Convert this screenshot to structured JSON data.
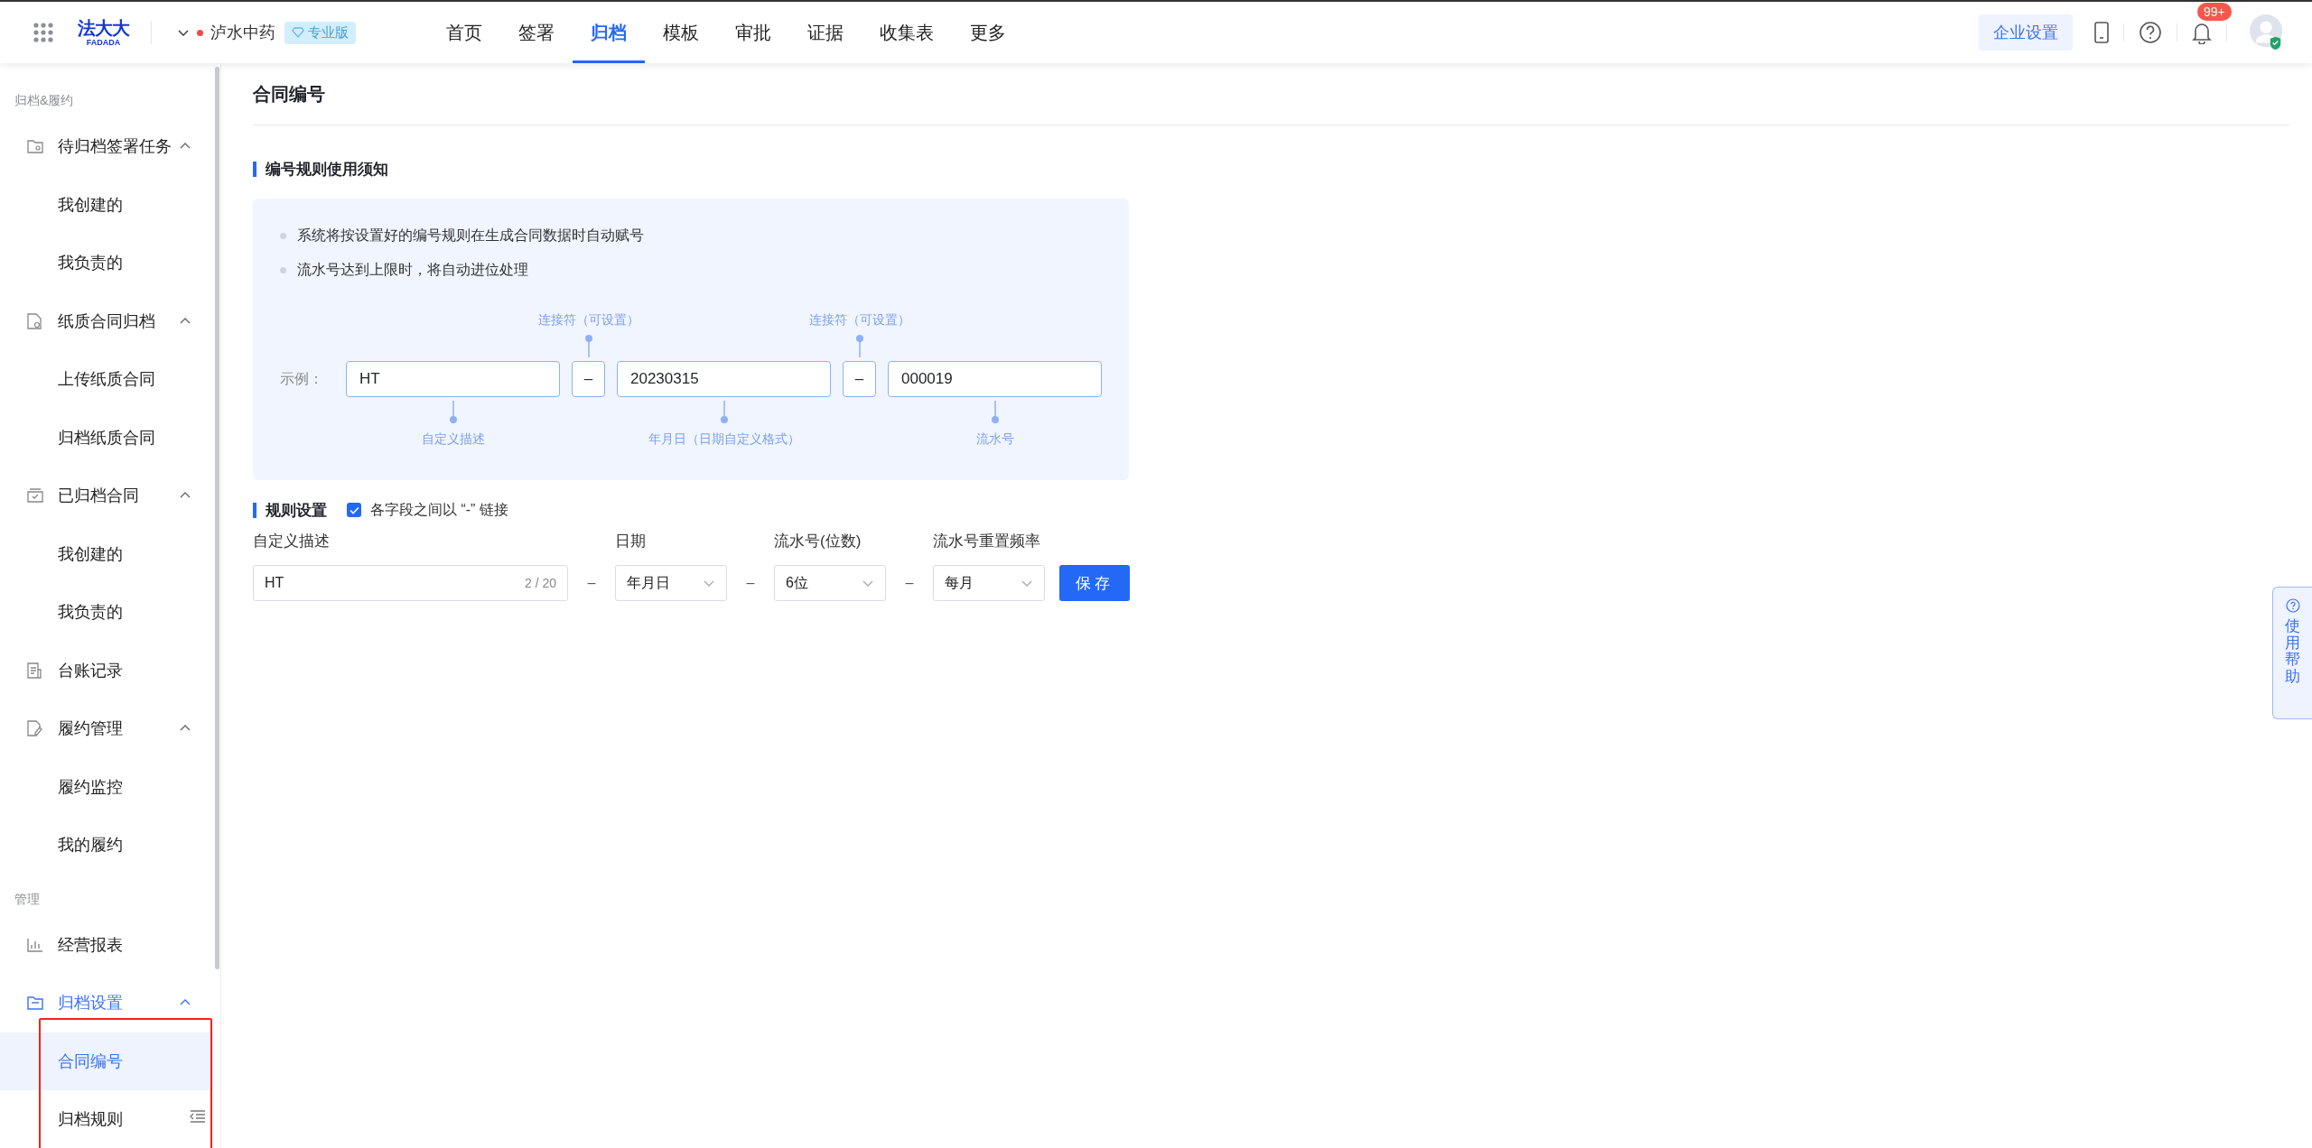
{
  "header": {
    "logo": {
      "name": "法大大",
      "latin": "FADADA"
    },
    "company": "泸水中药",
    "edition": "专业版",
    "nav": [
      {
        "label": "首页",
        "selected": false
      },
      {
        "label": "签署",
        "selected": false
      },
      {
        "label": "归档",
        "selected": true
      },
      {
        "label": "模板",
        "selected": false
      },
      {
        "label": "审批",
        "selected": false
      },
      {
        "label": "证据",
        "selected": false
      },
      {
        "label": "收集表",
        "selected": false
      },
      {
        "label": "更多",
        "selected": false
      }
    ],
    "settings_button": "企业设置",
    "notification_count": "99+"
  },
  "sidebar": {
    "sections": [
      {
        "title": "归档&履约",
        "items": [
          {
            "label": "待归档签署任务",
            "selected": false,
            "expanded": true,
            "children": [
              {
                "label": "我创建的",
                "selected": false
              },
              {
                "label": "我负责的",
                "selected": false
              }
            ]
          },
          {
            "label": "纸质合同归档",
            "selected": false,
            "expanded": true,
            "children": [
              {
                "label": "上传纸质合同",
                "selected": false
              },
              {
                "label": "归档纸质合同",
                "selected": false
              }
            ]
          },
          {
            "label": "已归档合同",
            "selected": false,
            "expanded": true,
            "children": [
              {
                "label": "我创建的",
                "selected": false
              },
              {
                "label": "我负责的",
                "selected": false
              }
            ]
          },
          {
            "label": "台账记录",
            "selected": false
          },
          {
            "label": "履约管理",
            "selected": false,
            "expanded": true,
            "children": [
              {
                "label": "履约监控",
                "selected": false
              },
              {
                "label": "我的履约",
                "selected": false
              }
            ]
          }
        ]
      },
      {
        "title": "管理",
        "items": [
          {
            "label": "经营报表",
            "selected": false
          },
          {
            "label": "归档设置",
            "selected": true,
            "expanded": true,
            "children": [
              {
                "label": "合同编号",
                "selected": true
              },
              {
                "label": "归档规则",
                "selected": false
              }
            ]
          }
        ]
      }
    ]
  },
  "page": {
    "title": "合同编号",
    "notice": {
      "title": "编号规则使用须知",
      "bullets": [
        "系统将按设置好的编号规则在生成合同数据时自动赋号",
        "流水号达到上限时，将自动进位处理"
      ],
      "example": {
        "label": "示例：",
        "segments": [
          {
            "kind": "field",
            "value": "HT",
            "caption": "自定义描述"
          },
          {
            "kind": "connector",
            "value": "–",
            "caption": "连接符（可设置）"
          },
          {
            "kind": "field",
            "value": "20230315",
            "caption": "年月日（日期自定义格式）"
          },
          {
            "kind": "connector",
            "value": "–",
            "caption": "连接符（可设置）"
          },
          {
            "kind": "field",
            "value": "000019",
            "caption": "流水号"
          }
        ]
      }
    },
    "rules": {
      "title": "规则设置",
      "join_checkbox": {
        "label": "各字段之间以 “-” 链接",
        "checked": true
      },
      "fields": [
        {
          "kind": "text",
          "label": "自定义描述",
          "value": "HT",
          "counter": "2 / 20"
        },
        {
          "kind": "separator",
          "text": "–"
        },
        {
          "kind": "select",
          "label": "日期",
          "value": "年月日"
        },
        {
          "kind": "separator",
          "text": "–"
        },
        {
          "kind": "select",
          "label": "流水号(位数)",
          "value": "6位"
        },
        {
          "kind": "separator",
          "text": "–"
        },
        {
          "kind": "select",
          "label": "流水号重置频率",
          "value": "每月"
        }
      ],
      "save_button": "保存"
    }
  },
  "help_tab": {
    "label": "使用帮助"
  }
}
